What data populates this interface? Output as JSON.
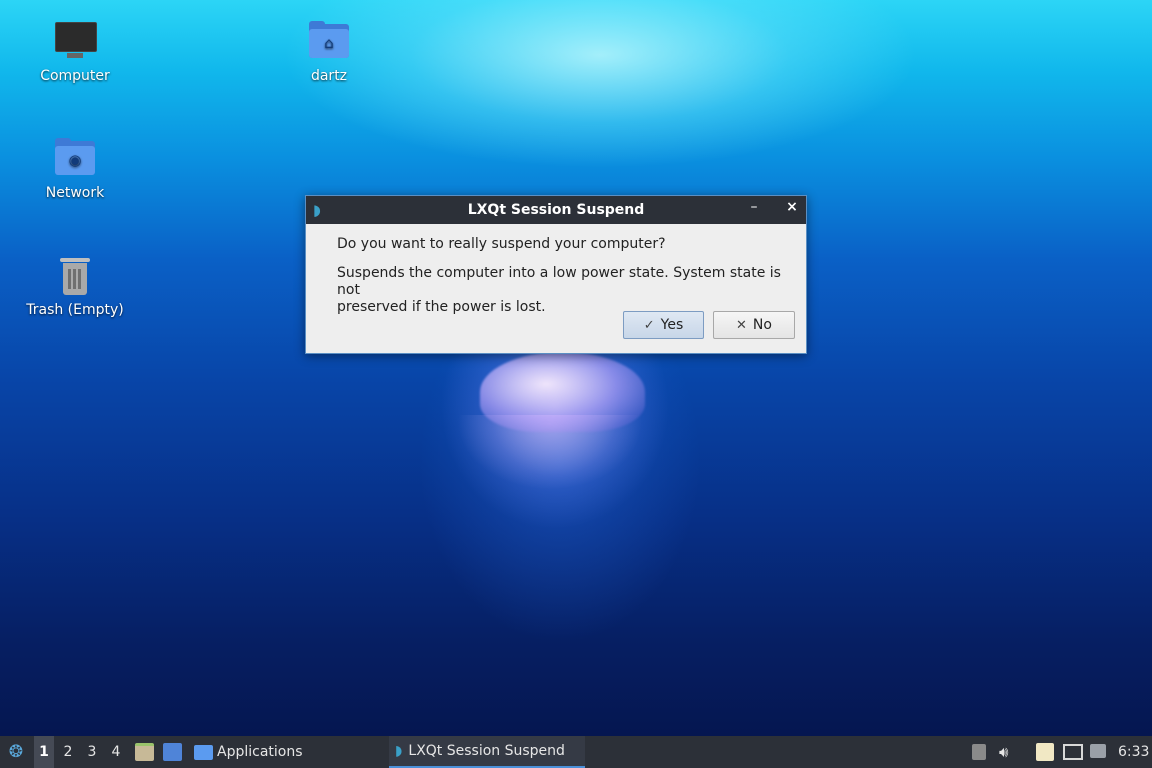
{
  "desktop": {
    "icons": [
      {
        "label": "Computer",
        "icon": "computer-icon"
      },
      {
        "label": "dartz",
        "icon": "home-folder-icon"
      },
      {
        "label": "Network",
        "icon": "network-icon"
      },
      {
        "label": "Trash (Empty)",
        "icon": "trash-icon"
      }
    ]
  },
  "dialog": {
    "title": "LXQt Session Suspend",
    "question": "Do you want to really suspend your computer?",
    "detail_line1": "Suspends the computer into a low power state. System state is not",
    "detail_line2": "preserved if the power is lost.",
    "yes_label": "Yes",
    "no_label": "No",
    "minimize_glyph": "–",
    "close_glyph": "×"
  },
  "taskbar": {
    "workspaces": [
      "1",
      "2",
      "3",
      "4"
    ],
    "active_workspace": "1",
    "apps_menu_label": "Applications",
    "task_label": "LXQt Session Suspend",
    "clock": "6:33"
  },
  "colors": {
    "panel": "#2c3038",
    "accent": "#4a90d9",
    "folder": "#5b9bf0"
  }
}
